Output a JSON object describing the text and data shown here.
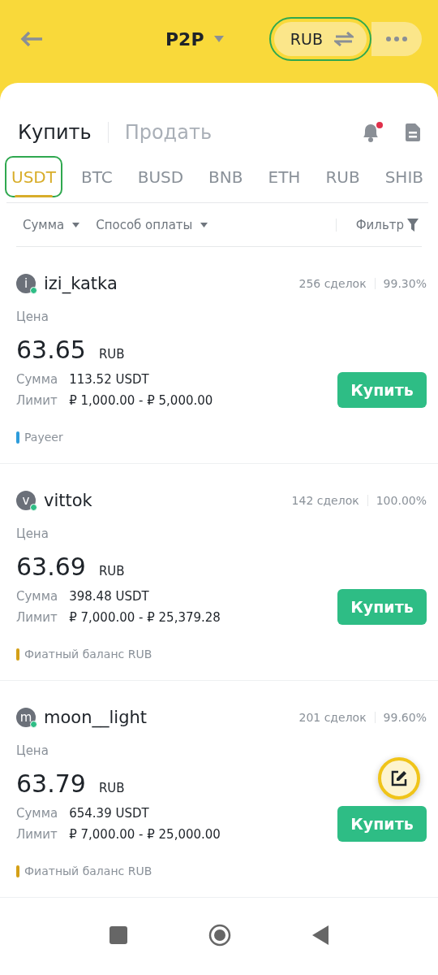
{
  "header": {
    "title": "P2P",
    "currency": {
      "label": "RUB",
      "highlighted": true
    }
  },
  "trade_tabs": [
    {
      "label": "Купить",
      "selected": true
    },
    {
      "label": "Продать",
      "selected": false
    }
  ],
  "alerts": {
    "unread": true
  },
  "asset_tabs": [
    {
      "label": "USDT",
      "selected": true,
      "highlighted": true
    },
    {
      "label": "BTC",
      "selected": false,
      "highlighted": false
    },
    {
      "label": "BUSD",
      "selected": false,
      "highlighted": false
    },
    {
      "label": "BNB",
      "selected": false,
      "highlighted": false
    },
    {
      "label": "ETH",
      "selected": false,
      "highlighted": false
    },
    {
      "label": "RUB",
      "selected": false,
      "highlighted": false
    },
    {
      "label": "SHIB",
      "selected": false,
      "highlighted": false
    }
  ],
  "filters": {
    "amount": "Сумма",
    "payment": "Способ оплаты",
    "filter": "Фильтр"
  },
  "offers": [
    {
      "avatar": "i",
      "name": "izi_katka",
      "online": true,
      "orders": "256 сделок",
      "completion": "99.30%",
      "price_label": "Цена",
      "price": "63.65",
      "fiat": "RUB",
      "amount_label": "Сумма",
      "amount": "113.52 USDT",
      "limit_label": "Лимит",
      "limit": "₽ 1,000.00 - ₽ 5,000.00",
      "button": "Купить",
      "payment": {
        "label": "Payeer",
        "color": "#2d9cdb"
      }
    },
    {
      "avatar": "v",
      "name": "vittok",
      "online": true,
      "orders": "142 сделок",
      "completion": "100.00%",
      "price_label": "Цена",
      "price": "63.69",
      "fiat": "RUB",
      "amount_label": "Сумма",
      "amount": "398.48 USDT",
      "limit_label": "Лимит",
      "limit": "₽ 7,000.00 - ₽ 25,379.28",
      "button": "Купить",
      "payment": {
        "label": "Фиатный баланс RUB",
        "color": "#d4a017"
      }
    },
    {
      "avatar": "m",
      "name": "moon__light",
      "online": true,
      "orders": "201 сделок",
      "completion": "99.60%",
      "price_label": "Цена",
      "price": "63.79",
      "fiat": "RUB",
      "amount_label": "Сумма",
      "amount": "654.39 USDT",
      "limit_label": "Лимит",
      "limit": "₽ 7,000.00 - ₽ 25,000.00",
      "button": "Купить",
      "payment": {
        "label": "Фиатный баланс RUB",
        "color": "#d4a017"
      }
    }
  ]
}
